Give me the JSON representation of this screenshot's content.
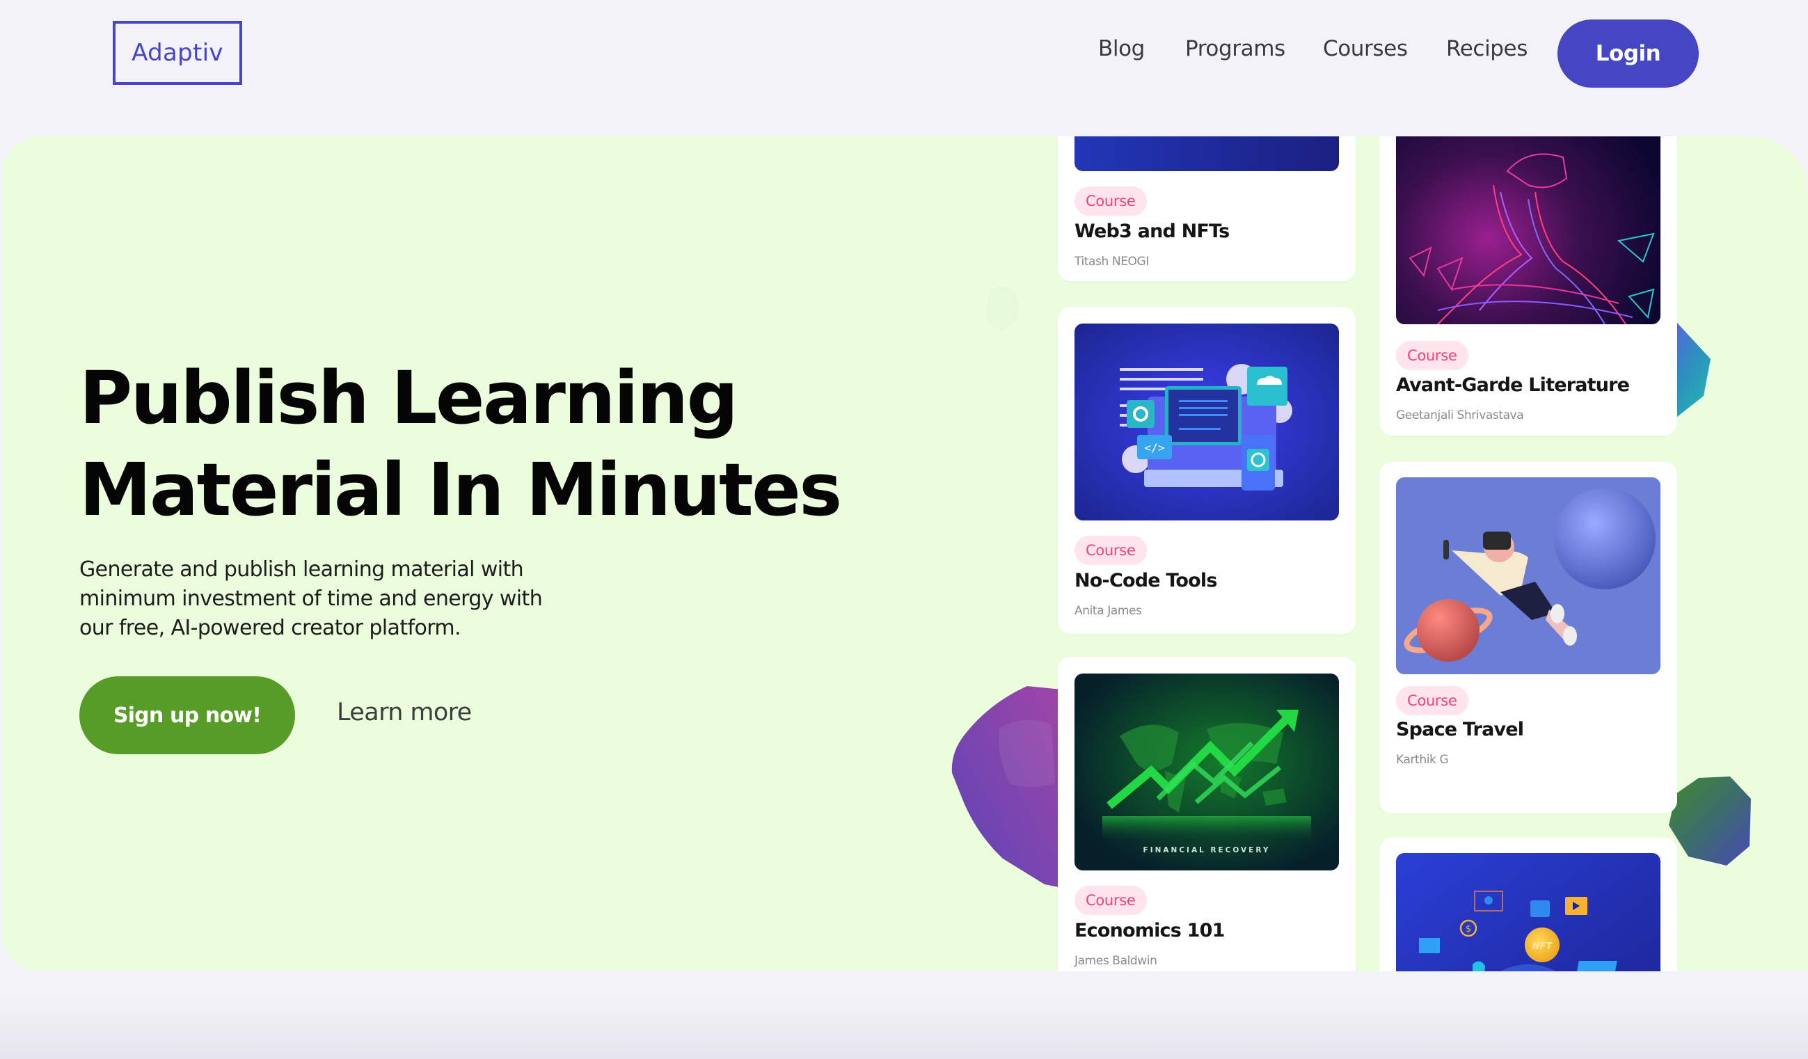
{
  "brand": {
    "logo_text": "Adaptiv",
    "accent": "#4646c4",
    "cta_green": "#589c28",
    "hero_bg": "#ebfddc",
    "tag_bg": "#ffe4ec",
    "tag_color": "#f0427a"
  },
  "nav": {
    "links": [
      {
        "label": "Blog"
      },
      {
        "label": "Programs"
      },
      {
        "label": "Courses"
      },
      {
        "label": "Recipes"
      }
    ],
    "login_label": "Login"
  },
  "hero": {
    "title_line1": "Publish Learning",
    "title_line2": "Material In Minutes",
    "subtitle": "Generate and publish learning material with minimum investment of time and energy with our free, AI-powered creator platform.",
    "signup_label": "Sign up now!",
    "learn_more_label": "Learn more"
  },
  "cards": [
    {
      "tag": "Course",
      "title": "Web3 and NFTs",
      "author": "Titash NEOGI",
      "image": "web3-illustration"
    },
    {
      "tag": "Course",
      "title": "No-Code Tools",
      "author": "Anita James",
      "image": "no-code-illustration"
    },
    {
      "tag": "Course",
      "title": "Economics 101",
      "author": "James Baldwin",
      "image": "financial-recovery-illustration",
      "image_caption": "FINANCIAL   RECOVERY"
    },
    {
      "tag": "Course",
      "title": "Avant-Garde Literature",
      "author": "Geetanjali Shrivastava",
      "image": "vr-wireframe-illustration"
    },
    {
      "tag": "Course",
      "title": "Space Travel",
      "author": "Karthik G",
      "image": "space-vr-illustration"
    },
    {
      "tag": "",
      "title": "",
      "author": "",
      "image": "nft-illustration",
      "image_label": "NFT"
    }
  ]
}
